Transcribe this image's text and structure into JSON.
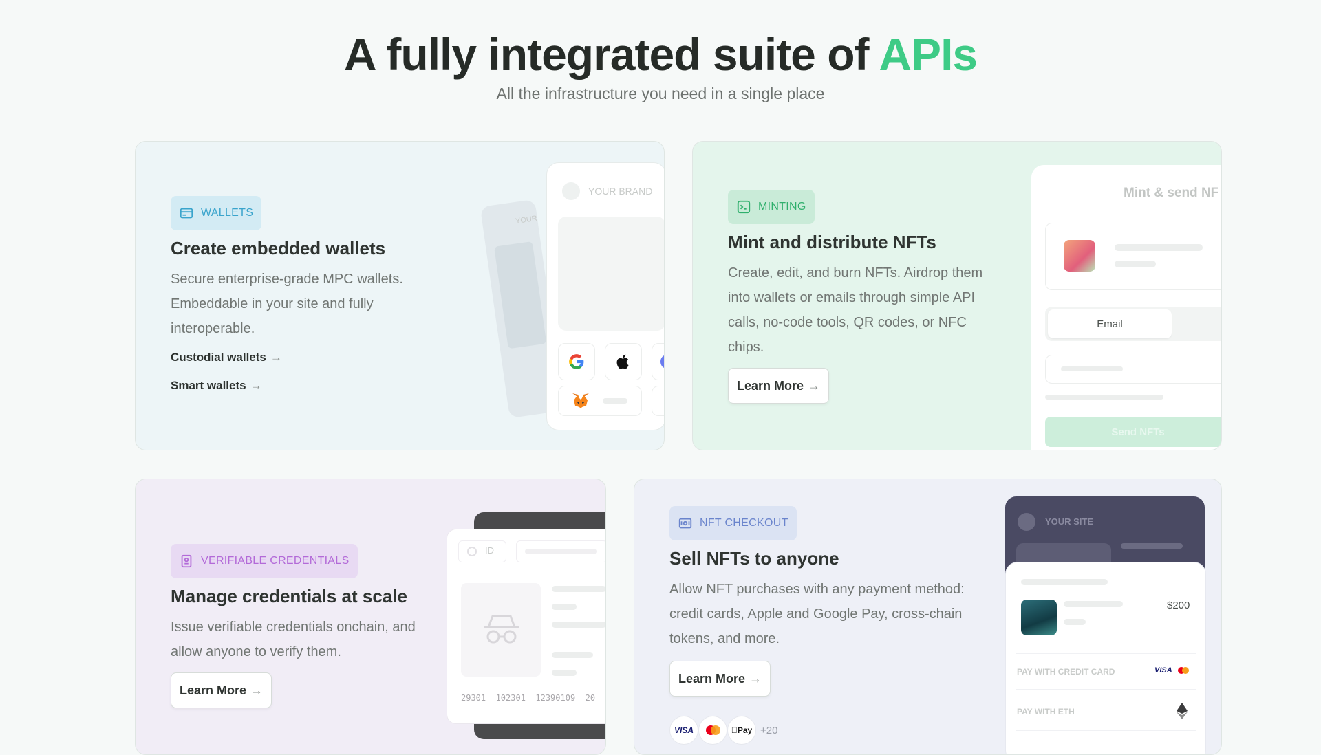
{
  "hero": {
    "title_prefix": "A fully integrated suite of ",
    "title_accent": "APIs",
    "subtitle": "All the infrastructure you need in a single place",
    "accent_color": "#3ecb86"
  },
  "wallets": {
    "badge": "WALLETS",
    "title": "Create embedded wallets",
    "description": "Secure enterprise-grade MPC wallets. Embeddable in your site and fully interoperable.",
    "links": [
      "Custodial wallets",
      "Smart wallets"
    ],
    "mock": {
      "brand_label": "YOUR BRAND",
      "back_label": "YOUR"
    },
    "icons": [
      "google-icon",
      "apple-icon",
      "metamask-fox-icon"
    ]
  },
  "minting": {
    "badge": "MINTING",
    "title": "Mint and distribute NFTs",
    "description": "Create, edit, and burn NFTs. Airdrop them into wallets or emails through simple API calls, no-code tools, QR codes, or NFC chips.",
    "button": "Learn More",
    "mock": {
      "header": "Mint & send NF",
      "email_label": "Email",
      "send_label": "Send NFTs"
    }
  },
  "credentials": {
    "badge": "VERIFIABLE CREDENTIALS",
    "title": "Manage credentials at scale",
    "description": "Issue verifiable credentials onchain, and allow anyone to verify them.",
    "button": "Learn More",
    "mock": {
      "id_label": "ID",
      "numbers": "29301  102301  12390109  20"
    }
  },
  "checkout": {
    "badge": "NFT CHECKOUT",
    "title": "Sell NFTs to anyone",
    "description": "Allow NFT purchases with any payment method: credit cards, Apple and Google Pay, cross-chain tokens, and more.",
    "button": "Learn More",
    "payment_methods": [
      "VISA",
      "Mastercard",
      "Pay"
    ],
    "payment_more": "+20",
    "mock": {
      "site_label": "YOUR SITE",
      "price": "$200",
      "pay_card_label": "PAY WITH CREDIT CARD",
      "pay_eth_label": "PAY WITH ETH",
      "card_brand": "VISA"
    }
  }
}
